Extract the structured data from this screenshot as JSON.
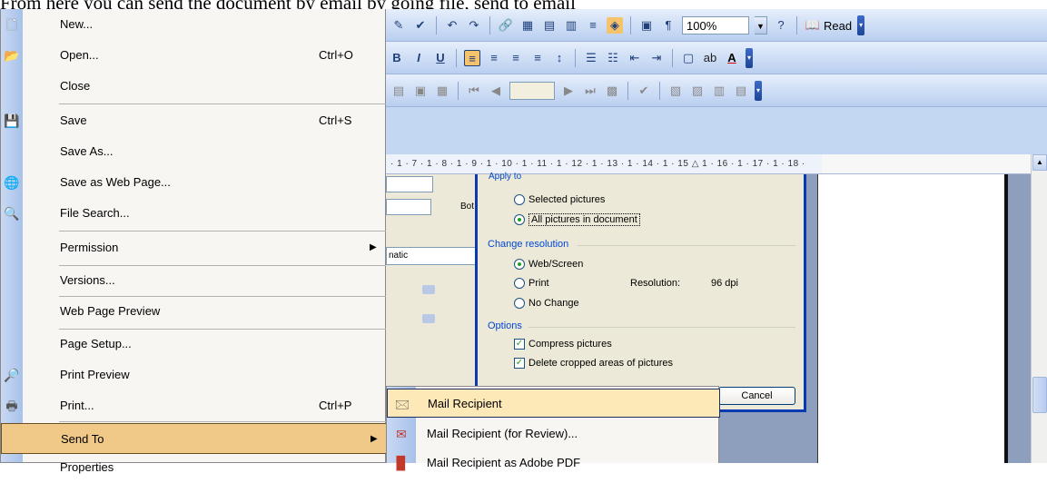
{
  "caption": "From here you can send the document by email by going file, send to email",
  "toolbar": {
    "zoom": "100%",
    "read_label": "Read"
  },
  "ruler": {
    "marks": "· 1 · 7 · 1 · 8 · 1 · 9 · 1 · 10 · 1 · 11 · 1 · 12 · 1 · 13 · 1 · 14 · 1 · 15 △ 1 · 16 · 1 · 17 · 1 · 18 ·"
  },
  "left_dialog": {
    "label_bot": "Bot",
    "field_text": "natic"
  },
  "dialog": {
    "apply_to_partial": "Apply to",
    "selected_pictures": "Selected pictures",
    "all_pictures": "All pictures in document",
    "change_resolution": "Change resolution",
    "web_screen": "Web/Screen",
    "print": "Print",
    "no_change": "No Change",
    "resolution_label": "Resolution:",
    "resolution_value": "96 dpi",
    "options": "Options",
    "compress": "Compress pictures",
    "delete_cropped": "Delete cropped areas of pictures",
    "cancel": "Cancel"
  },
  "file_menu": {
    "items": [
      {
        "label": "New...",
        "shortcut": ""
      },
      {
        "label": "Open...",
        "shortcut": "Ctrl+O"
      },
      {
        "label": "Close",
        "shortcut": ""
      },
      {
        "label": "Save",
        "shortcut": "Ctrl+S"
      },
      {
        "label": "Save As...",
        "shortcut": ""
      },
      {
        "label": "Save as Web Page...",
        "shortcut": ""
      },
      {
        "label": "File Search...",
        "shortcut": ""
      },
      {
        "label": "Permission",
        "shortcut": ""
      },
      {
        "label": "Versions...",
        "shortcut": ""
      },
      {
        "label": "Web Page Preview",
        "shortcut": ""
      },
      {
        "label": "Page Setup...",
        "shortcut": ""
      },
      {
        "label": "Print Preview",
        "shortcut": ""
      },
      {
        "label": "Print...",
        "shortcut": "Ctrl+P"
      },
      {
        "label": "Send To",
        "shortcut": ""
      },
      {
        "label": "Properties",
        "shortcut": ""
      }
    ]
  },
  "send_to_menu": {
    "items": [
      {
        "label": "Mail Recipient"
      },
      {
        "label": "Mail Recipient (for Review)..."
      },
      {
        "label": "Mail Recipient as Adobe PDF"
      }
    ]
  },
  "colors": {
    "menu_highlight": "#f0c989",
    "submenu_highlight": "#fde9b8",
    "dialog_border": "#0a3ab1"
  }
}
